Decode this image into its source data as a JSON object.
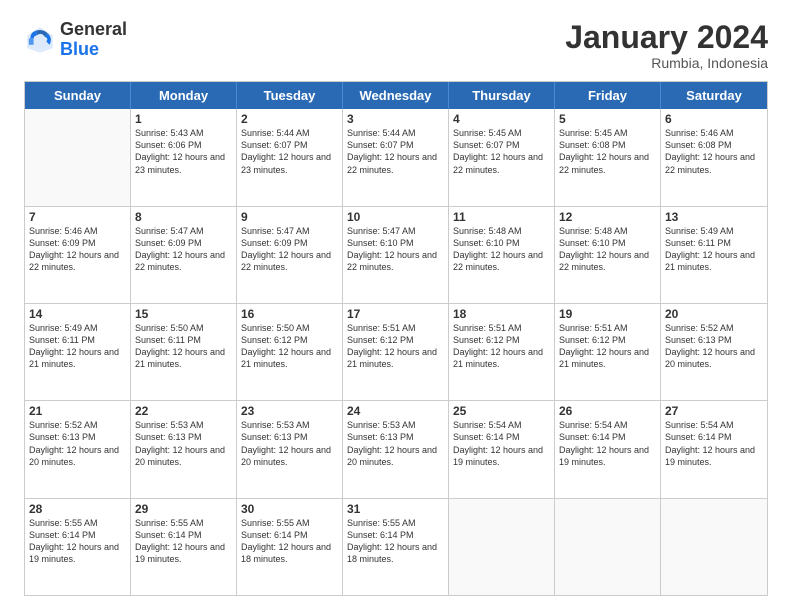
{
  "header": {
    "logo_general": "General",
    "logo_blue": "Blue",
    "month_year": "January 2024",
    "location": "Rumbia, Indonesia"
  },
  "weekdays": [
    "Sunday",
    "Monday",
    "Tuesday",
    "Wednesday",
    "Thursday",
    "Friday",
    "Saturday"
  ],
  "rows": [
    [
      {
        "day": "",
        "sunrise": "",
        "sunset": "",
        "daylight": ""
      },
      {
        "day": "1",
        "sunrise": "Sunrise: 5:43 AM",
        "sunset": "Sunset: 6:06 PM",
        "daylight": "Daylight: 12 hours and 23 minutes."
      },
      {
        "day": "2",
        "sunrise": "Sunrise: 5:44 AM",
        "sunset": "Sunset: 6:07 PM",
        "daylight": "Daylight: 12 hours and 23 minutes."
      },
      {
        "day": "3",
        "sunrise": "Sunrise: 5:44 AM",
        "sunset": "Sunset: 6:07 PM",
        "daylight": "Daylight: 12 hours and 22 minutes."
      },
      {
        "day": "4",
        "sunrise": "Sunrise: 5:45 AM",
        "sunset": "Sunset: 6:07 PM",
        "daylight": "Daylight: 12 hours and 22 minutes."
      },
      {
        "day": "5",
        "sunrise": "Sunrise: 5:45 AM",
        "sunset": "Sunset: 6:08 PM",
        "daylight": "Daylight: 12 hours and 22 minutes."
      },
      {
        "day": "6",
        "sunrise": "Sunrise: 5:46 AM",
        "sunset": "Sunset: 6:08 PM",
        "daylight": "Daylight: 12 hours and 22 minutes."
      }
    ],
    [
      {
        "day": "7",
        "sunrise": "Sunrise: 5:46 AM",
        "sunset": "Sunset: 6:09 PM",
        "daylight": "Daylight: 12 hours and 22 minutes."
      },
      {
        "day": "8",
        "sunrise": "Sunrise: 5:47 AM",
        "sunset": "Sunset: 6:09 PM",
        "daylight": "Daylight: 12 hours and 22 minutes."
      },
      {
        "day": "9",
        "sunrise": "Sunrise: 5:47 AM",
        "sunset": "Sunset: 6:09 PM",
        "daylight": "Daylight: 12 hours and 22 minutes."
      },
      {
        "day": "10",
        "sunrise": "Sunrise: 5:47 AM",
        "sunset": "Sunset: 6:10 PM",
        "daylight": "Daylight: 12 hours and 22 minutes."
      },
      {
        "day": "11",
        "sunrise": "Sunrise: 5:48 AM",
        "sunset": "Sunset: 6:10 PM",
        "daylight": "Daylight: 12 hours and 22 minutes."
      },
      {
        "day": "12",
        "sunrise": "Sunrise: 5:48 AM",
        "sunset": "Sunset: 6:10 PM",
        "daylight": "Daylight: 12 hours and 22 minutes."
      },
      {
        "day": "13",
        "sunrise": "Sunrise: 5:49 AM",
        "sunset": "Sunset: 6:11 PM",
        "daylight": "Daylight: 12 hours and 21 minutes."
      }
    ],
    [
      {
        "day": "14",
        "sunrise": "Sunrise: 5:49 AM",
        "sunset": "Sunset: 6:11 PM",
        "daylight": "Daylight: 12 hours and 21 minutes."
      },
      {
        "day": "15",
        "sunrise": "Sunrise: 5:50 AM",
        "sunset": "Sunset: 6:11 PM",
        "daylight": "Daylight: 12 hours and 21 minutes."
      },
      {
        "day": "16",
        "sunrise": "Sunrise: 5:50 AM",
        "sunset": "Sunset: 6:12 PM",
        "daylight": "Daylight: 12 hours and 21 minutes."
      },
      {
        "day": "17",
        "sunrise": "Sunrise: 5:51 AM",
        "sunset": "Sunset: 6:12 PM",
        "daylight": "Daylight: 12 hours and 21 minutes."
      },
      {
        "day": "18",
        "sunrise": "Sunrise: 5:51 AM",
        "sunset": "Sunset: 6:12 PM",
        "daylight": "Daylight: 12 hours and 21 minutes."
      },
      {
        "day": "19",
        "sunrise": "Sunrise: 5:51 AM",
        "sunset": "Sunset: 6:12 PM",
        "daylight": "Daylight: 12 hours and 21 minutes."
      },
      {
        "day": "20",
        "sunrise": "Sunrise: 5:52 AM",
        "sunset": "Sunset: 6:13 PM",
        "daylight": "Daylight: 12 hours and 20 minutes."
      }
    ],
    [
      {
        "day": "21",
        "sunrise": "Sunrise: 5:52 AM",
        "sunset": "Sunset: 6:13 PM",
        "daylight": "Daylight: 12 hours and 20 minutes."
      },
      {
        "day": "22",
        "sunrise": "Sunrise: 5:53 AM",
        "sunset": "Sunset: 6:13 PM",
        "daylight": "Daylight: 12 hours and 20 minutes."
      },
      {
        "day": "23",
        "sunrise": "Sunrise: 5:53 AM",
        "sunset": "Sunset: 6:13 PM",
        "daylight": "Daylight: 12 hours and 20 minutes."
      },
      {
        "day": "24",
        "sunrise": "Sunrise: 5:53 AM",
        "sunset": "Sunset: 6:13 PM",
        "daylight": "Daylight: 12 hours and 20 minutes."
      },
      {
        "day": "25",
        "sunrise": "Sunrise: 5:54 AM",
        "sunset": "Sunset: 6:14 PM",
        "daylight": "Daylight: 12 hours and 19 minutes."
      },
      {
        "day": "26",
        "sunrise": "Sunrise: 5:54 AM",
        "sunset": "Sunset: 6:14 PM",
        "daylight": "Daylight: 12 hours and 19 minutes."
      },
      {
        "day": "27",
        "sunrise": "Sunrise: 5:54 AM",
        "sunset": "Sunset: 6:14 PM",
        "daylight": "Daylight: 12 hours and 19 minutes."
      }
    ],
    [
      {
        "day": "28",
        "sunrise": "Sunrise: 5:55 AM",
        "sunset": "Sunset: 6:14 PM",
        "daylight": "Daylight: 12 hours and 19 minutes."
      },
      {
        "day": "29",
        "sunrise": "Sunrise: 5:55 AM",
        "sunset": "Sunset: 6:14 PM",
        "daylight": "Daylight: 12 hours and 19 minutes."
      },
      {
        "day": "30",
        "sunrise": "Sunrise: 5:55 AM",
        "sunset": "Sunset: 6:14 PM",
        "daylight": "Daylight: 12 hours and 18 minutes."
      },
      {
        "day": "31",
        "sunrise": "Sunrise: 5:55 AM",
        "sunset": "Sunset: 6:14 PM",
        "daylight": "Daylight: 12 hours and 18 minutes."
      },
      {
        "day": "",
        "sunrise": "",
        "sunset": "",
        "daylight": ""
      },
      {
        "day": "",
        "sunrise": "",
        "sunset": "",
        "daylight": ""
      },
      {
        "day": "",
        "sunrise": "",
        "sunset": "",
        "daylight": ""
      }
    ]
  ]
}
